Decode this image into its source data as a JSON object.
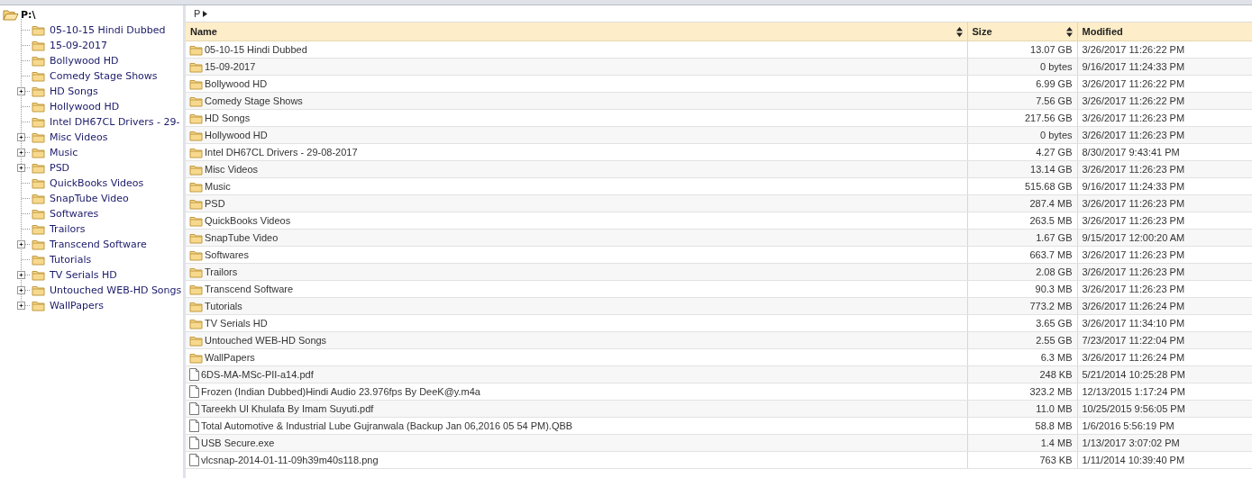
{
  "tree": {
    "root": {
      "label": "P:\\",
      "expanded": true
    },
    "items": [
      {
        "label": "05-10-15 Hindi Dubbed",
        "expandable": false
      },
      {
        "label": "15-09-2017",
        "expandable": false
      },
      {
        "label": "Bollywood HD",
        "expandable": false
      },
      {
        "label": "Comedy Stage Shows",
        "expandable": false
      },
      {
        "label": "HD Songs",
        "expandable": true
      },
      {
        "label": "Hollywood HD",
        "expandable": false
      },
      {
        "label": "Intel DH67CL Drivers - 29-",
        "expandable": false
      },
      {
        "label": "Misc Videos",
        "expandable": true
      },
      {
        "label": "Music",
        "expandable": true
      },
      {
        "label": "PSD",
        "expandable": true
      },
      {
        "label": "QuickBooks Videos",
        "expandable": false
      },
      {
        "label": "SnapTube Video",
        "expandable": false
      },
      {
        "label": "Softwares",
        "expandable": false
      },
      {
        "label": "Trailors",
        "expandable": false
      },
      {
        "label": "Transcend Software",
        "expandable": true
      },
      {
        "label": "Tutorials",
        "expandable": false
      },
      {
        "label": "TV Serials HD",
        "expandable": true
      },
      {
        "label": "Untouched WEB-HD Songs",
        "expandable": true
      },
      {
        "label": "WallPapers",
        "expandable": true
      }
    ]
  },
  "breadcrumb": {
    "segments": [
      "P"
    ]
  },
  "table": {
    "columns": [
      {
        "label": "Name",
        "sortable": true
      },
      {
        "label": "Size",
        "sortable": true
      },
      {
        "label": "Modified",
        "sortable": false
      }
    ],
    "rows": [
      {
        "kind": "folder",
        "name": "05-10-15 Hindi Dubbed",
        "size": "13.07 GB",
        "modified": "3/26/2017 11:26:22 PM"
      },
      {
        "kind": "folder",
        "name": "15-09-2017",
        "size": "0 bytes",
        "modified": "9/16/2017 11:24:33 PM"
      },
      {
        "kind": "folder",
        "name": "Bollywood HD",
        "size": "6.99 GB",
        "modified": "3/26/2017 11:26:22 PM"
      },
      {
        "kind": "folder",
        "name": "Comedy Stage Shows",
        "size": "7.56 GB",
        "modified": "3/26/2017 11:26:22 PM"
      },
      {
        "kind": "folder",
        "name": "HD Songs",
        "size": "217.56 GB",
        "modified": "3/26/2017 11:26:23 PM"
      },
      {
        "kind": "folder",
        "name": "Hollywood HD",
        "size": "0 bytes",
        "modified": "3/26/2017 11:26:23 PM"
      },
      {
        "kind": "folder",
        "name": "Intel DH67CL Drivers - 29-08-2017",
        "size": "4.27 GB",
        "modified": "8/30/2017 9:43:41 PM"
      },
      {
        "kind": "folder",
        "name": "Misc Videos",
        "size": "13.14 GB",
        "modified": "3/26/2017 11:26:23 PM"
      },
      {
        "kind": "folder",
        "name": "Music",
        "size": "515.68 GB",
        "modified": "9/16/2017 11:24:33 PM"
      },
      {
        "kind": "folder",
        "name": "PSD",
        "size": "287.4 MB",
        "modified": "3/26/2017 11:26:23 PM"
      },
      {
        "kind": "folder",
        "name": "QuickBooks Videos",
        "size": "263.5 MB",
        "modified": "3/26/2017 11:26:23 PM"
      },
      {
        "kind": "folder",
        "name": "SnapTube Video",
        "size": "1.67 GB",
        "modified": "9/15/2017 12:00:20 AM"
      },
      {
        "kind": "folder",
        "name": "Softwares",
        "size": "663.7 MB",
        "modified": "3/26/2017 11:26:23 PM"
      },
      {
        "kind": "folder",
        "name": "Trailors",
        "size": "2.08 GB",
        "modified": "3/26/2017 11:26:23 PM"
      },
      {
        "kind": "folder",
        "name": "Transcend Software",
        "size": "90.3 MB",
        "modified": "3/26/2017 11:26:23 PM"
      },
      {
        "kind": "folder",
        "name": "Tutorials",
        "size": "773.2 MB",
        "modified": "3/26/2017 11:26:24 PM"
      },
      {
        "kind": "folder",
        "name": "TV Serials HD",
        "size": "3.65 GB",
        "modified": "3/26/2017 11:34:10 PM"
      },
      {
        "kind": "folder",
        "name": "Untouched WEB-HD Songs",
        "size": "2.55 GB",
        "modified": "7/23/2017 11:22:04 PM"
      },
      {
        "kind": "folder",
        "name": "WallPapers",
        "size": "6.3 MB",
        "modified": "3/26/2017 11:26:24 PM"
      },
      {
        "kind": "file",
        "name": "6DS-MA-MSc-PII-a14.pdf",
        "size": "248 KB",
        "modified": "5/21/2014 10:25:28 PM"
      },
      {
        "kind": "file",
        "name": "Frozen (Indian Dubbed)Hindi Audio 23.976fps By DeeK@y.m4a",
        "size": "323.2 MB",
        "modified": "12/13/2015 1:17:24 PM"
      },
      {
        "kind": "file",
        "name": "Tareekh Ul Khulafa By Imam Suyuti.pdf",
        "size": "11.0 MB",
        "modified": "10/25/2015 9:56:05 PM"
      },
      {
        "kind": "file",
        "name": "Total Automotive & Industrial Lube Gujranwala (Backup Jan 06,2016 05 54 PM).QBB",
        "size": "58.8 MB",
        "modified": "1/6/2016 5:56:19 PM"
      },
      {
        "kind": "file",
        "name": "USB Secure.exe",
        "size": "1.4 MB",
        "modified": "1/13/2017 3:07:02 PM"
      },
      {
        "kind": "file",
        "name": "vlcsnap-2014-01-11-09h39m40s118.png",
        "size": "763 KB",
        "modified": "1/11/2014 10:39:40 PM"
      }
    ]
  }
}
